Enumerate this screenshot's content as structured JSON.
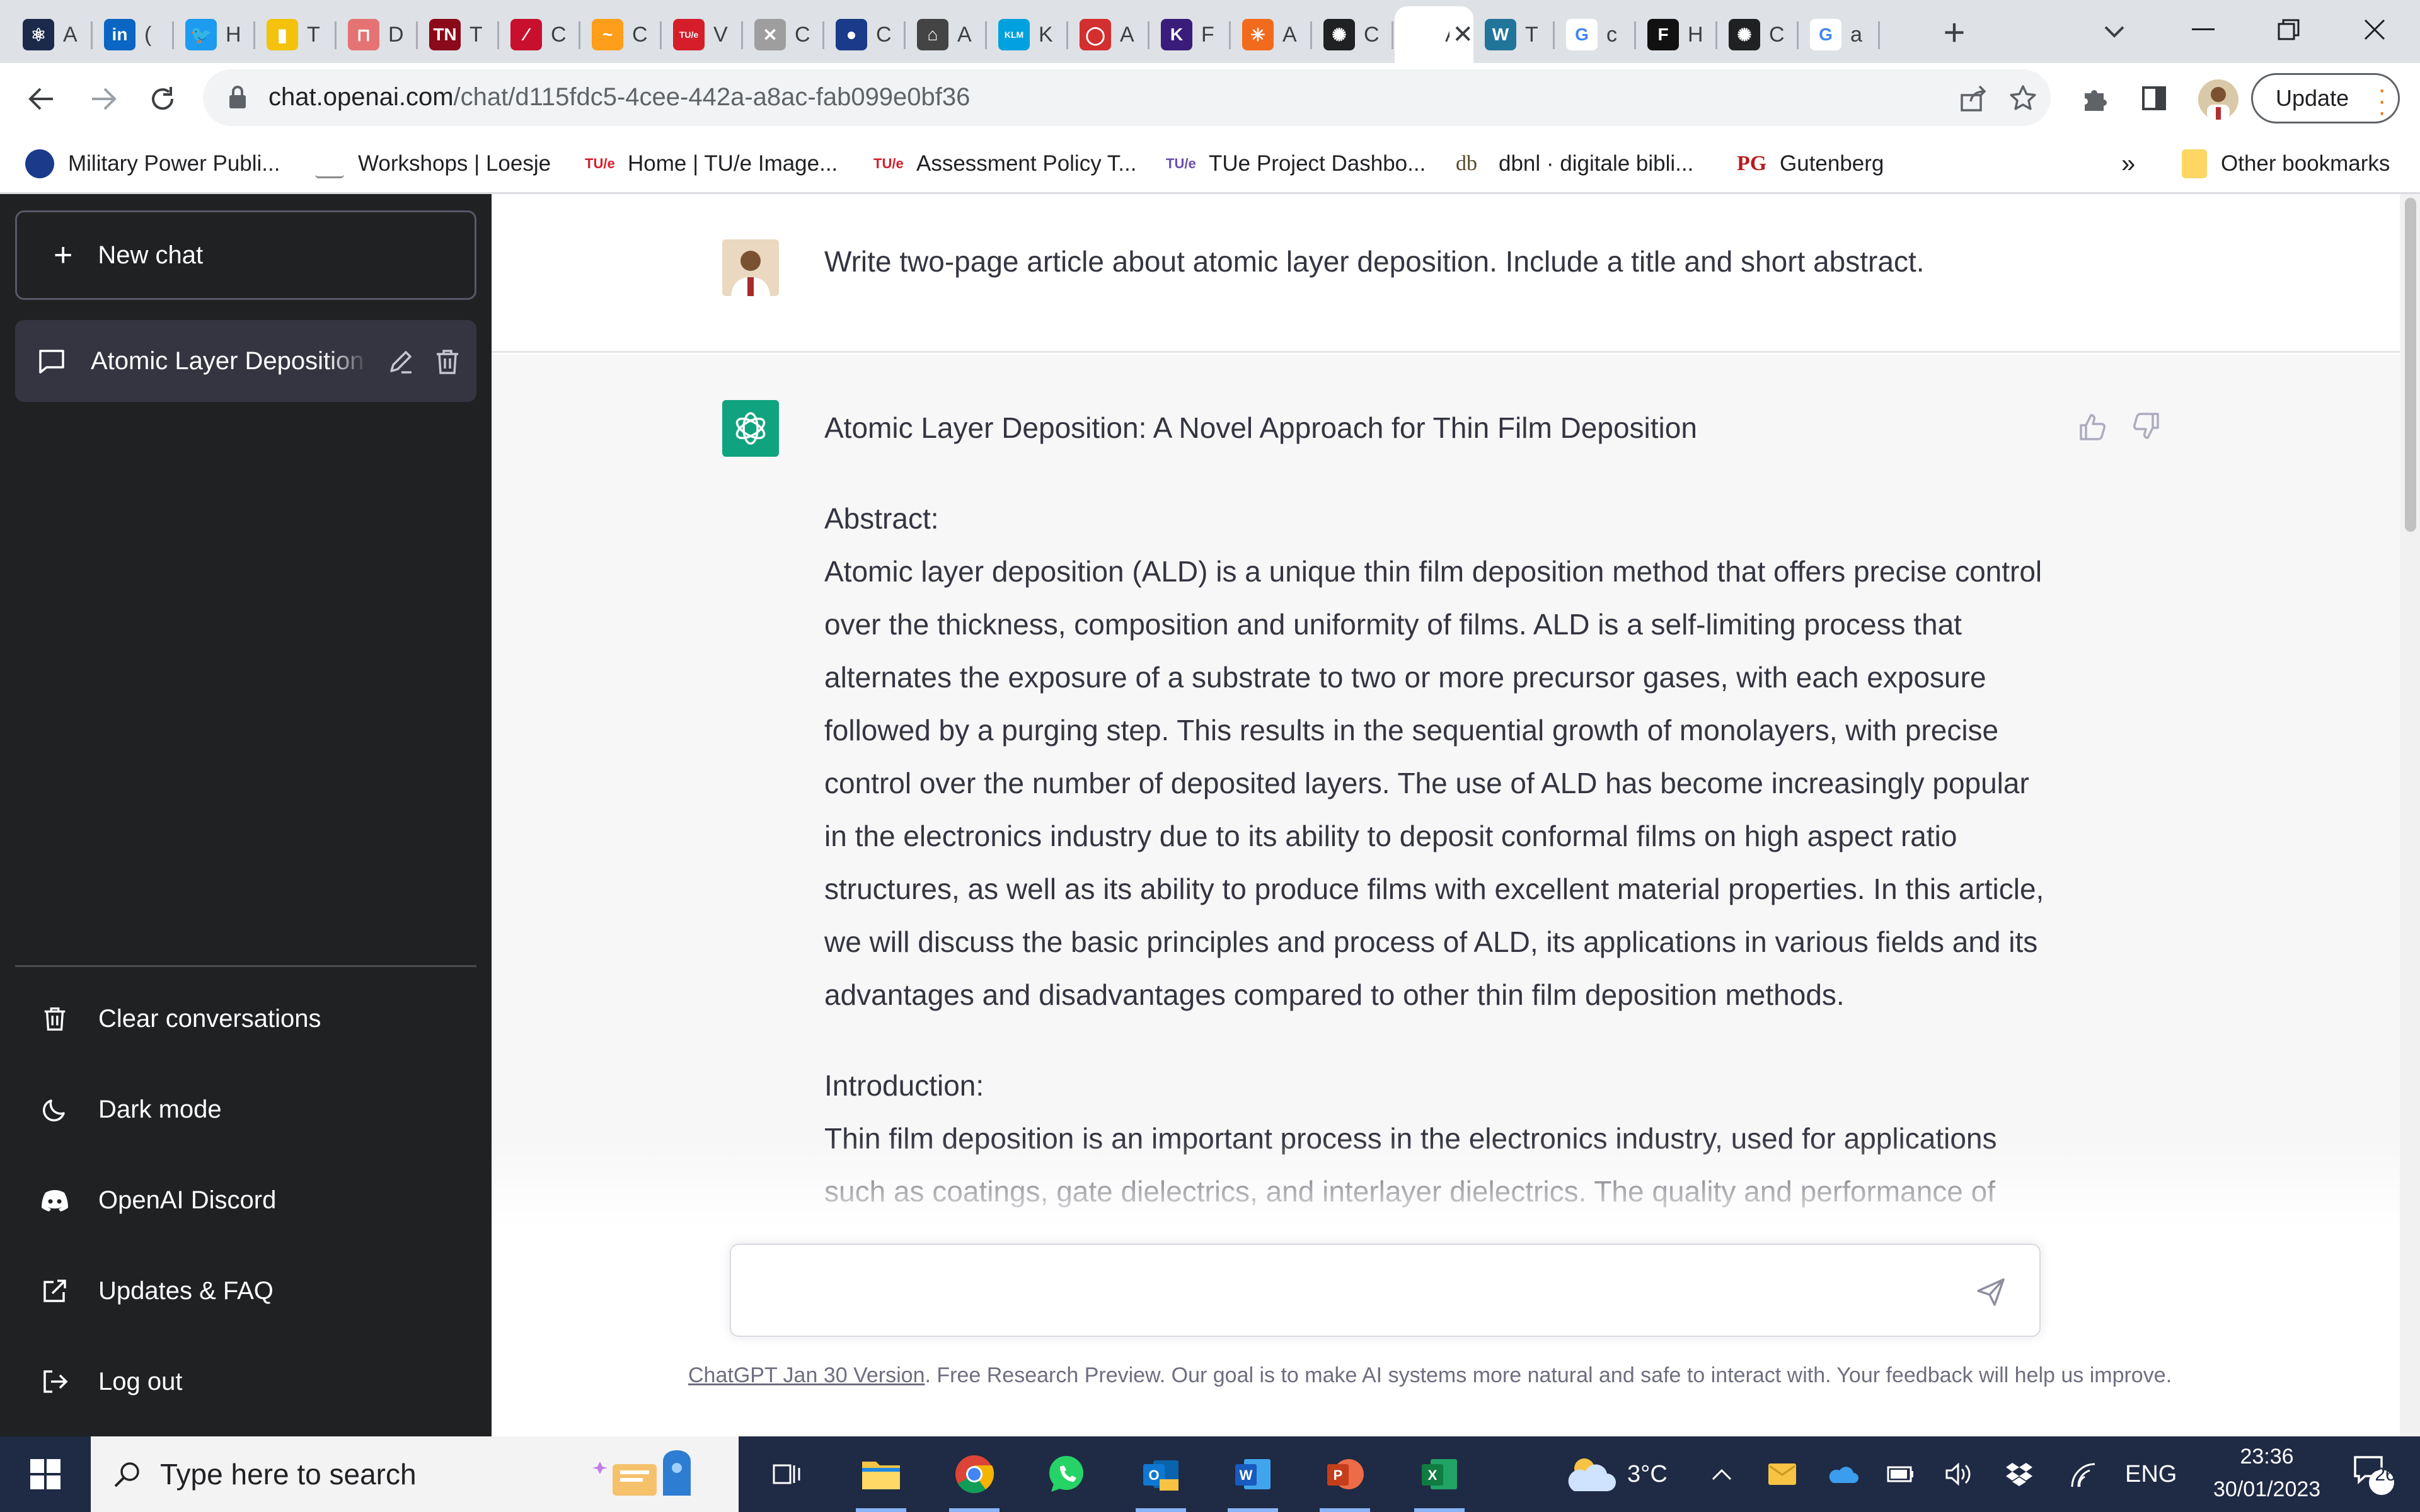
{
  "browser": {
    "tabs": [
      {
        "title": "A",
        "favicon_color": "#1b2a4a",
        "glyph": "⚛"
      },
      {
        "title": "(",
        "favicon_color": "#0a66c2",
        "glyph": "in"
      },
      {
        "title": "H",
        "favicon_color": "#1d9bf0",
        "glyph": "🐦"
      },
      {
        "title": "T",
        "favicon_color": "#f4c20d",
        "glyph": "▮"
      },
      {
        "title": "D",
        "favicon_color": "#e57373",
        "glyph": "⊓"
      },
      {
        "title": "T",
        "favicon_color": "#8b0a1a",
        "glyph": "TN"
      },
      {
        "title": "C",
        "favicon_color": "#c8102e",
        "glyph": "⁄"
      },
      {
        "title": "C",
        "favicon_color": "#ff9e1b",
        "glyph": "~"
      },
      {
        "title": "V",
        "favicon_color": "#d61e2a",
        "glyph": "TU/e"
      },
      {
        "title": "C",
        "favicon_color": "#9e9e9e",
        "glyph": "✕"
      },
      {
        "title": "C",
        "favicon_color": "#1a3a8a",
        "glyph": "●"
      },
      {
        "title": "A",
        "favicon_color": "#444444",
        "glyph": "⌂"
      },
      {
        "title": "K",
        "favicon_color": "#00a1de",
        "glyph": "KLM"
      },
      {
        "title": "A",
        "favicon_color": "#d32f2f",
        "glyph": "◯"
      },
      {
        "title": "F",
        "favicon_color": "#3a1d7a",
        "glyph": "K"
      },
      {
        "title": "A",
        "favicon_color": "#f26b1d",
        "glyph": "✳"
      },
      {
        "title": "C",
        "favicon_color": "#202123",
        "glyph": "✺"
      },
      {
        "title": "A",
        "favicon_color": "#ffffff",
        "glyph": "",
        "active": true
      },
      {
        "title": "T",
        "favicon_color": "#21759b",
        "glyph": "W"
      },
      {
        "title": "c",
        "favicon_color": "#ffffff",
        "glyph": "G"
      },
      {
        "title": "H",
        "favicon_color": "#111111",
        "glyph": "F"
      },
      {
        "title": "C",
        "favicon_color": "#202123",
        "glyph": "✺"
      },
      {
        "title": "a",
        "favicon_color": "#ffffff",
        "glyph": "G"
      }
    ],
    "url_host": "chat.openai.com",
    "url_path": "/chat/d115fdc5-4cee-442a-a8ac-fab099e0bf36",
    "update_label": "Update",
    "bookmarks": [
      {
        "label": "Military Power Publi...",
        "icon_color": "#1a3a8a"
      },
      {
        "label": "Workshops | Loesje",
        "icon_color": "#888888"
      },
      {
        "label": "Home | TU/e Image...",
        "icon_color": "#d61e2a"
      },
      {
        "label": "Assessment Policy T...",
        "icon_color": "#d61e2a"
      },
      {
        "label": "TUe Project Dashbo...",
        "icon_color": "#6a4fb3"
      },
      {
        "label": "dbnl · digitale bibli...",
        "icon_color": "#5a4a2a"
      },
      {
        "label": "Gutenberg",
        "icon_color": "#b71c1c"
      }
    ],
    "more_bookmarks": "»",
    "other_bookmarks": "Other bookmarks"
  },
  "sidebar": {
    "new_chat": "New chat",
    "conversation": "Atomic Layer Deposition",
    "links": [
      {
        "label": "Clear conversations",
        "icon": "trash-icon"
      },
      {
        "label": "Dark mode",
        "icon": "moon-icon"
      },
      {
        "label": "OpenAI Discord",
        "icon": "discord-icon"
      },
      {
        "label": "Updates & FAQ",
        "icon": "external-link-icon"
      },
      {
        "label": "Log out",
        "icon": "logout-icon"
      }
    ]
  },
  "chat": {
    "user_message": "Write two-page article about atomic layer deposition. Include a title and short abstract.",
    "response": {
      "title": "Atomic Layer Deposition: A Novel Approach for Thin Film Deposition",
      "abstract_heading": "Abstract:",
      "abstract": "Atomic layer deposition (ALD) is a unique thin film deposition method that offers precise control over the thickness, composition and uniformity of films. ALD is a self-limiting process that alternates the exposure of a substrate to two or more precursor gases, with each exposure followed by a purging step. This results in the sequential growth of monolayers, with precise control over the number of deposited layers. The use of ALD has become increasingly popular in the electronics industry due to its ability to deposit conformal films on high aspect ratio structures, as well as its ability to produce films with excellent material properties. In this article, we will discuss the basic principles and process of ALD, its applications in various fields and its advantages and disadvantages compared to other thin film deposition methods.",
      "intro_heading": "Introduction:",
      "intro": "Thin film deposition is an important process in the electronics industry, used for applications such as coatings, gate dielectrics, and interlayer dielectrics. The quality and performance of"
    },
    "input_placeholder": "",
    "footer_link": "ChatGPT Jan 30 Version",
    "footer_text": ". Free Research Preview. Our goal is to make AI systems more natural and safe to interact with. Your feedback will help us improve."
  },
  "taskbar": {
    "search_placeholder": "Type here to search",
    "temperature": "3°C",
    "language": "ENG",
    "time": "23:36",
    "date": "30/01/2023",
    "notification_count": "26"
  },
  "colors": {
    "sidebar_bg": "#202123",
    "accent": "#10a37f",
    "response_bg": "#f7f7f8"
  }
}
